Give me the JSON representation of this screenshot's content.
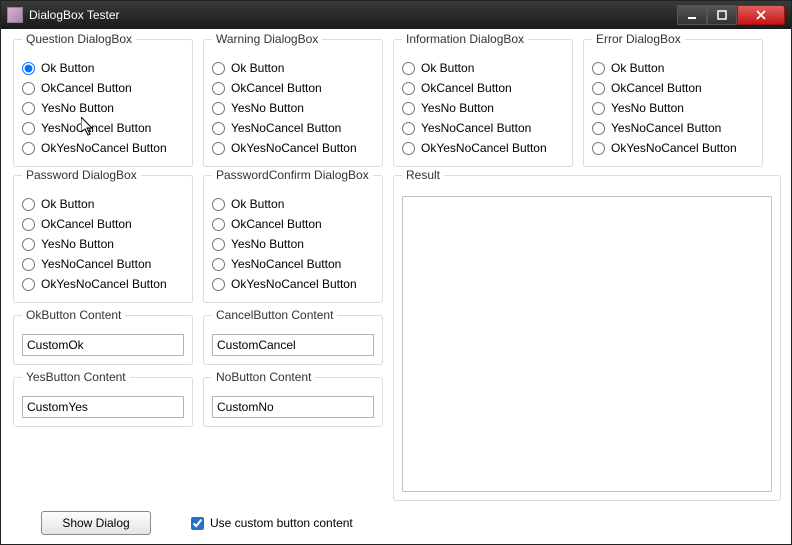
{
  "window": {
    "title": "DialogBox Tester"
  },
  "radio_options": {
    "0": "Ok Button",
    "1": "OkCancel Button",
    "2": "YesNo Button",
    "3": "YesNoCancel Button",
    "4": "OkYesNoCancel Button"
  },
  "groups": {
    "question": {
      "legend": "Question DialogBox"
    },
    "warning": {
      "legend": "Warning DialogBox"
    },
    "information": {
      "legend": "Information DialogBox"
    },
    "error": {
      "legend": "Error DialogBox"
    },
    "password": {
      "legend": "Password DialogBox"
    },
    "passwordconfirm": {
      "legend": "PasswordConfirm DialogBox"
    },
    "result": {
      "legend": "Result"
    },
    "okbtn": {
      "legend": "OkButton Content",
      "value": "CustomOk"
    },
    "cancelbtn": {
      "legend": "CancelButton Content",
      "value": "CustomCancel"
    },
    "yesbtn": {
      "legend": "YesButton Content",
      "value": "CustomYes"
    },
    "nobtn": {
      "legend": "NoButton Content",
      "value": "CustomNo"
    }
  },
  "actions": {
    "show_dialog": "Show Dialog",
    "use_custom": "Use custom button content"
  },
  "state": {
    "selected_group": "question",
    "selected_index": 0,
    "use_custom_checked": true
  }
}
